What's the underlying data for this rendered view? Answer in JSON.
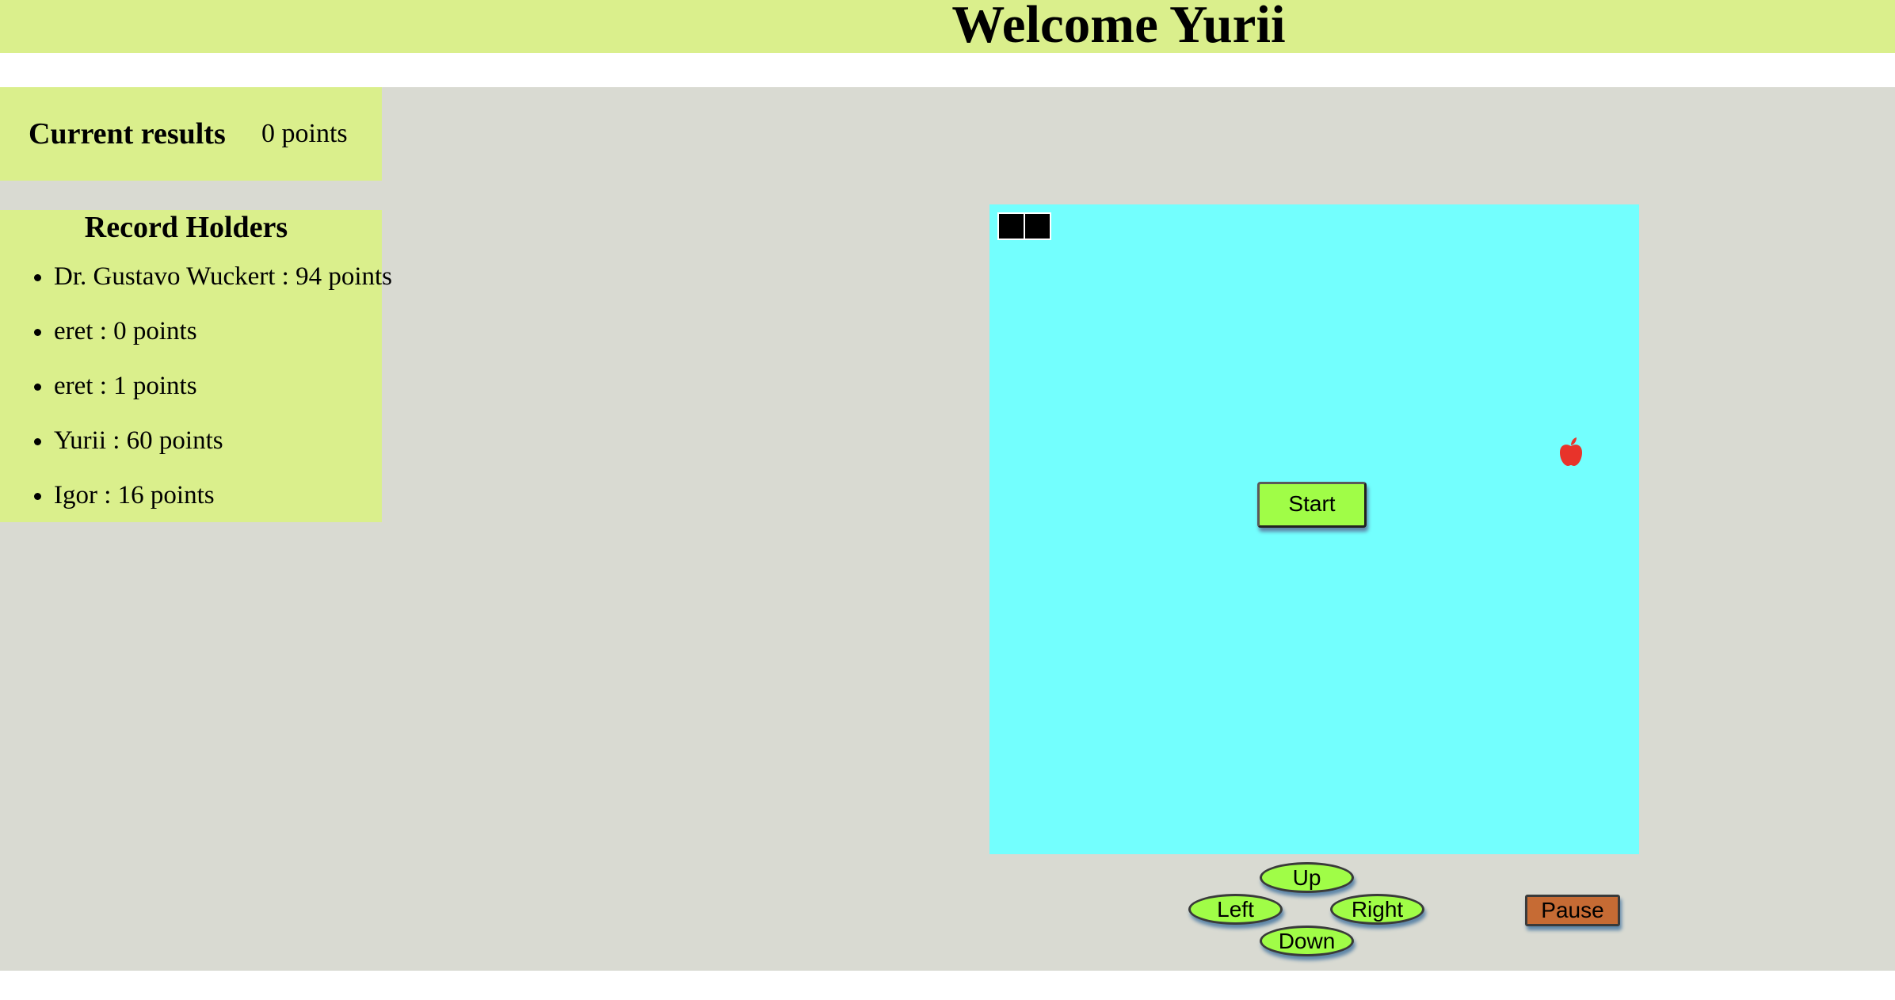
{
  "header": {
    "title": "Welcome Yurii"
  },
  "results": {
    "title": "Current results",
    "value": "0 points"
  },
  "records": {
    "title": "Record Holders",
    "items": [
      "Dr. Gustavo Wuckert : 94 points",
      "eret : 0 points",
      "eret : 1 points",
      "Yurii : 60 points",
      "Igor : 16 points"
    ]
  },
  "board": {
    "snake_length": 2,
    "apple_icon": "apple-icon",
    "colors": {
      "board": "#73fffe",
      "snake": "#000000",
      "apple": "#e8332a",
      "panel": "#daef8c",
      "background": "#d9dad2"
    }
  },
  "controls": {
    "start": "Start",
    "up": "Up",
    "left": "Left",
    "right": "Right",
    "down": "Down",
    "pause": "Pause",
    "colors": {
      "button": "#a0fd47",
      "pause": "#c66b34"
    }
  }
}
